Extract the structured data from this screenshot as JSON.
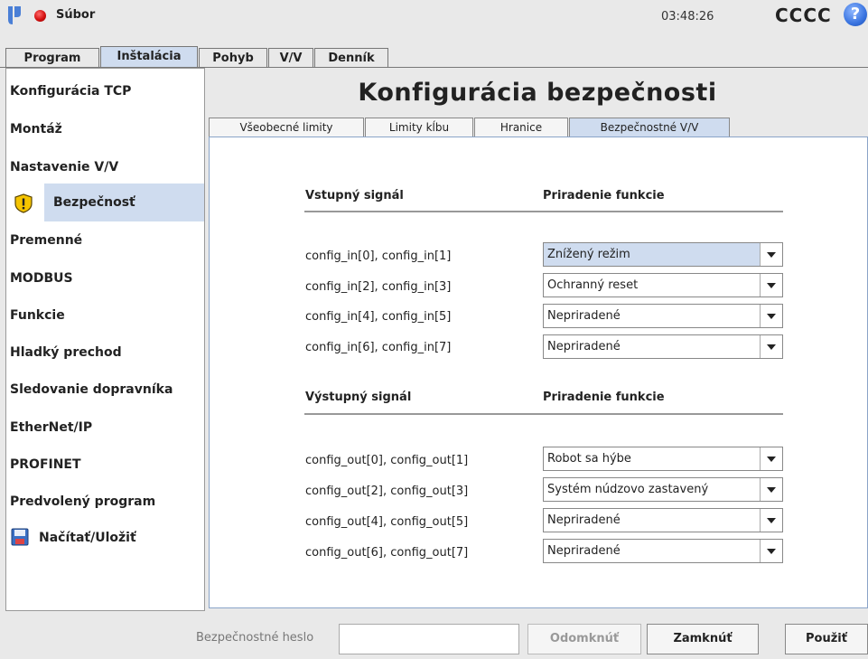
{
  "topbar": {
    "file_label": "Súbor",
    "clock": "03:48:26",
    "robot_name": "CCCC",
    "help_icon": "?"
  },
  "main_tabs": [
    {
      "label": "Program"
    },
    {
      "label": "Inštalácia"
    },
    {
      "label": "Pohyb"
    },
    {
      "label": "V/V"
    },
    {
      "label": "Denník"
    }
  ],
  "sidebar": {
    "items": [
      {
        "label": "Konfigurácia TCP"
      },
      {
        "label": "Montáž"
      },
      {
        "label": "Nastavenie V/V"
      },
      {
        "label": "Bezpečnosť",
        "icon": "warning-shield-icon"
      },
      {
        "label": "Premenné"
      },
      {
        "label": "MODBUS"
      },
      {
        "label": "Funkcie"
      },
      {
        "label": "Hladký prechod"
      },
      {
        "label": "Sledovanie dopravníka"
      },
      {
        "label": "EtherNet/IP"
      },
      {
        "label": "PROFINET"
      },
      {
        "label": "Predvolený program"
      },
      {
        "label": "Načítať/Uložiť",
        "icon": "floppy-disk-icon"
      }
    ]
  },
  "page": {
    "title": "Konfigurácia bezpečnosti",
    "tabs": [
      {
        "label": "Všeobecné limity"
      },
      {
        "label": "Limity kĺbu"
      },
      {
        "label": "Hranice"
      },
      {
        "label": "Bezpečnostné V/V"
      }
    ]
  },
  "inputs": {
    "signal_header": "Vstupný signál",
    "function_header": "Priradenie funkcie",
    "rows": [
      {
        "signal": "config_in[0], config_in[1]",
        "value": "Znížený režim"
      },
      {
        "signal": "config_in[2], config_in[3]",
        "value": "Ochranný reset"
      },
      {
        "signal": "config_in[4], config_in[5]",
        "value": "Nepriradené"
      },
      {
        "signal": "config_in[6], config_in[7]",
        "value": "Nepriradené"
      }
    ]
  },
  "outputs": {
    "signal_header": "Výstupný signál",
    "function_header": "Priradenie funkcie",
    "rows": [
      {
        "signal": "config_out[0], config_out[1]",
        "value": "Robot sa hýbe"
      },
      {
        "signal": "config_out[2], config_out[3]",
        "value": "Systém núdzovo zastavený"
      },
      {
        "signal": "config_out[4], config_out[5]",
        "value": "Nepriradené"
      },
      {
        "signal": "config_out[6], config_out[7]",
        "value": "Nepriradené"
      }
    ]
  },
  "bottom": {
    "password_label": "Bezpečnostné heslo",
    "password_value": "",
    "unlock_label": "Odomknúť",
    "lock_label": "Zamknúť",
    "apply_label": "Použiť"
  },
  "colors": {
    "active_tab": "#cfdcef",
    "background": "#e9e9e9",
    "status_red": "#d41010",
    "help_blue": "#3a74e0",
    "warning_yellow": "#f5c400"
  }
}
